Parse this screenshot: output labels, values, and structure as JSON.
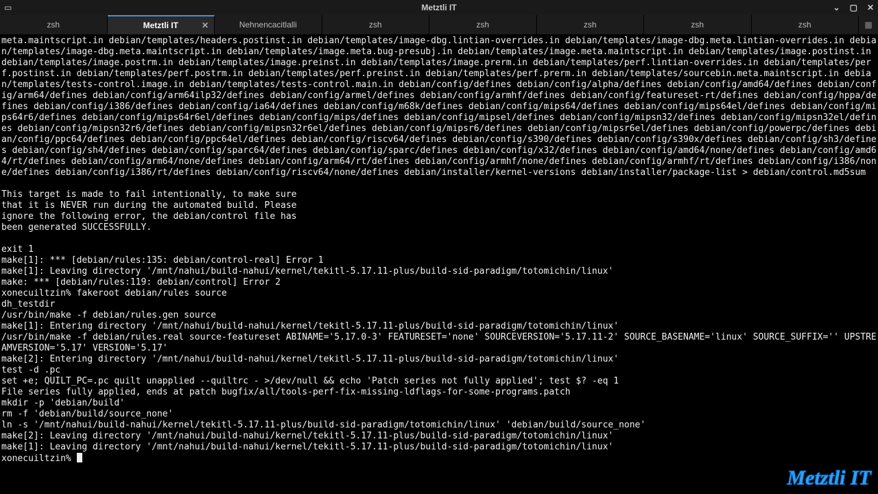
{
  "window": {
    "title": "Metztli IT"
  },
  "titlebar_buttons": {
    "minimize": "⌄",
    "maximize": "▢",
    "close": "✕"
  },
  "tabs": [
    {
      "label": "zsh",
      "active": false
    },
    {
      "label": "Metztli IT",
      "active": true,
      "closable": true
    },
    {
      "label": "Nehnencacitlalli",
      "active": false
    },
    {
      "label": "zsh",
      "active": false
    },
    {
      "label": "zsh",
      "active": false
    },
    {
      "label": "zsh",
      "active": false
    },
    {
      "label": "zsh",
      "active": false
    },
    {
      "label": "zsh",
      "active": false
    }
  ],
  "terminal": {
    "block1": "meta.maintscript.in debian/templates/headers.postinst.in debian/templates/image-dbg.lintian-overrides.in debian/templates/image-dbg.meta.lintian-overrides.in debian/templates/image-dbg.meta.maintscript.in debian/templates/image.meta.bug-presubj.in debian/templates/image.meta.maintscript.in debian/templates/image.postinst.in debian/templates/image.postrm.in debian/templates/image.preinst.in debian/templates/image.prerm.in debian/templates/perf.lintian-overrides.in debian/templates/perf.postinst.in debian/templates/perf.postrm.in debian/templates/perf.preinst.in debian/templates/perf.prerm.in debian/templates/sourcebin.meta.maintscript.in debian/templates/tests-control.image.in debian/templates/tests-control.main.in debian/config/defines debian/config/alpha/defines debian/config/amd64/defines debian/config/arm64/defines debian/config/arm64ilp32/defines debian/config/armel/defines debian/config/armhf/defines debian/config/featureset-rt/defines debian/config/hppa/defines debian/config/i386/defines debian/config/ia64/defines debian/config/m68k/defines debian/config/mips64/defines debian/config/mips64el/defines debian/config/mips64r6/defines debian/config/mips64r6el/defines debian/config/mips/defines debian/config/mipsel/defines debian/config/mipsn32/defines debian/config/mipsn32el/defines debian/config/mipsn32r6/defines debian/config/mipsn32r6el/defines debian/config/mipsr6/defines debian/config/mipsr6el/defines debian/config/powerpc/defines debian/config/ppc64/defines debian/config/ppc64el/defines debian/config/riscv64/defines debian/config/s390/defines debian/config/s390x/defines debian/config/sh3/defines debian/config/sh4/defines debian/config/sparc64/defines debian/config/sparc/defines debian/config/x32/defines debian/config/amd64/none/defines debian/config/amd64/rt/defines debian/config/arm64/none/defines debian/config/arm64/rt/defines debian/config/armhf/none/defines debian/config/armhf/rt/defines debian/config/i386/none/defines debian/config/i386/rt/defines debian/config/riscv64/none/defines debian/installer/kernel-versions debian/installer/package-list > debian/control.md5sum",
    "msg1": "This target is made to fail intentionally, to make sure",
    "msg2": "that it is NEVER run during the automated build. Please",
    "msg3": "ignore the following error, the debian/control file has",
    "msg4": "been generated SUCCESSFULLY.",
    "exit": "exit 1",
    "make1": "make[1]: *** [debian/rules:135: debian/control-real] Error 1",
    "make2": "make[1]: Leaving directory '/mnt/nahui/build-nahui/kernel/tekitl-5.17.11-plus/build-sid-paradigm/totomichin/linux'",
    "make3": "make: *** [debian/rules:119: debian/control] Error 2",
    "prompt1": "xonecuiltzin% fakeroot debian/rules source",
    "dh": "dh_testdir",
    "usrbin1": "/usr/bin/make -f debian/rules.gen source",
    "make4": "make[1]: Entering directory '/mnt/nahui/build-nahui/kernel/tekitl-5.17.11-plus/build-sid-paradigm/totomichin/linux'",
    "usrbin2": "/usr/bin/make -f debian/rules.real source-featureset ABINAME='5.17.0-3' FEATURESET='none' SOURCEVERSION='5.17.11-2' SOURCE_BASENAME='linux' SOURCE_SUFFIX='' UPSTREAMVERSION='5.17' VERSION='5.17'",
    "make5": "make[2]: Entering directory '/mnt/nahui/build-nahui/kernel/tekitl-5.17.11-plus/build-sid-paradigm/totomichin/linux'",
    "test": "test -d .pc",
    "set": "set +e; QUILT_PC=.pc quilt unapplied --quiltrc - >/dev/null && echo 'Patch series not fully applied'; test $? -eq 1",
    "file": "File series fully applied, ends at patch bugfix/all/tools-perf-fix-missing-ldflags-for-some-programs.patch",
    "mkdir": "mkdir -p 'debian/build'",
    "rm": "rm -f 'debian/build/source_none'",
    "ln": "ln -s '/mnt/nahui/build-nahui/kernel/tekitl-5.17.11-plus/build-sid-paradigm/totomichin/linux' 'debian/build/source_none'",
    "make6": "make[2]: Leaving directory '/mnt/nahui/build-nahui/kernel/tekitl-5.17.11-plus/build-sid-paradigm/totomichin/linux'",
    "make7": "make[1]: Leaving directory '/mnt/nahui/build-nahui/kernel/tekitl-5.17.11-plus/build-sid-paradigm/totomichin/linux'",
    "prompt2": "xonecuiltzin% "
  },
  "watermark": "Metztli IT"
}
